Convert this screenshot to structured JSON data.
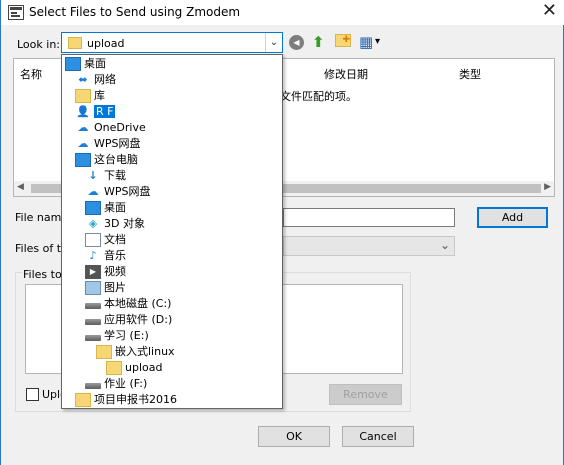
{
  "window": {
    "title": "Select Files to Send using Zmodem",
    "close_glyph": "✕"
  },
  "lookin": {
    "label": "Look in:",
    "value": "upload"
  },
  "toolbar": {
    "back_glyph": "◀",
    "up_glyph": "⬆",
    "newfolder_glyph": "✚",
    "view_glyph": "▦",
    "view_arrow": "▾"
  },
  "filelist": {
    "col_name": "名称",
    "col_date": "修改日期",
    "col_type": "类型",
    "empty_message": "文件匹配的项。"
  },
  "filename": {
    "label": "File name",
    "value": ""
  },
  "filetype": {
    "label": "Files of typ"
  },
  "files_to_send": {
    "label": "Files to"
  },
  "upload_checkbox": {
    "label": "Uplo"
  },
  "buttons": {
    "add": "Add",
    "remove": "Remove",
    "ok": "OK",
    "cancel": "Cancel"
  },
  "dropdown": {
    "items": [
      {
        "label": "桌面",
        "icon": "desktop-icon"
      },
      {
        "label": "网络",
        "icon": "network-icon"
      },
      {
        "label": "库",
        "icon": "library-icon"
      },
      {
        "label": "R F",
        "icon": "user-icon"
      },
      {
        "label": "OneDrive",
        "icon": "cloud-icon"
      },
      {
        "label": "WPS网盘",
        "icon": "cloud-icon"
      },
      {
        "label": "这台电脑",
        "icon": "computer-icon"
      },
      {
        "label": "下载",
        "icon": "download-icon"
      },
      {
        "label": "WPS网盘",
        "icon": "cloud-icon"
      },
      {
        "label": "桌面",
        "icon": "desktop-icon"
      },
      {
        "label": "3D 对象",
        "icon": "cube-icon"
      },
      {
        "label": "文档",
        "icon": "document-icon"
      },
      {
        "label": "音乐",
        "icon": "music-icon"
      },
      {
        "label": "视频",
        "icon": "video-icon"
      },
      {
        "label": "图片",
        "icon": "picture-icon"
      },
      {
        "label": "本地磁盘 (C:)",
        "icon": "drive-icon"
      },
      {
        "label": "应用软件 (D:)",
        "icon": "drive-icon"
      },
      {
        "label": "学习 (E:)",
        "icon": "drive-icon"
      },
      {
        "label": "嵌入式linux",
        "icon": "folder-icon"
      },
      {
        "label": "upload",
        "icon": "folder-icon"
      },
      {
        "label": "作业 (F:)",
        "icon": "drive-icon"
      },
      {
        "label": "项目申报书2016",
        "icon": "folder-icon"
      }
    ]
  }
}
